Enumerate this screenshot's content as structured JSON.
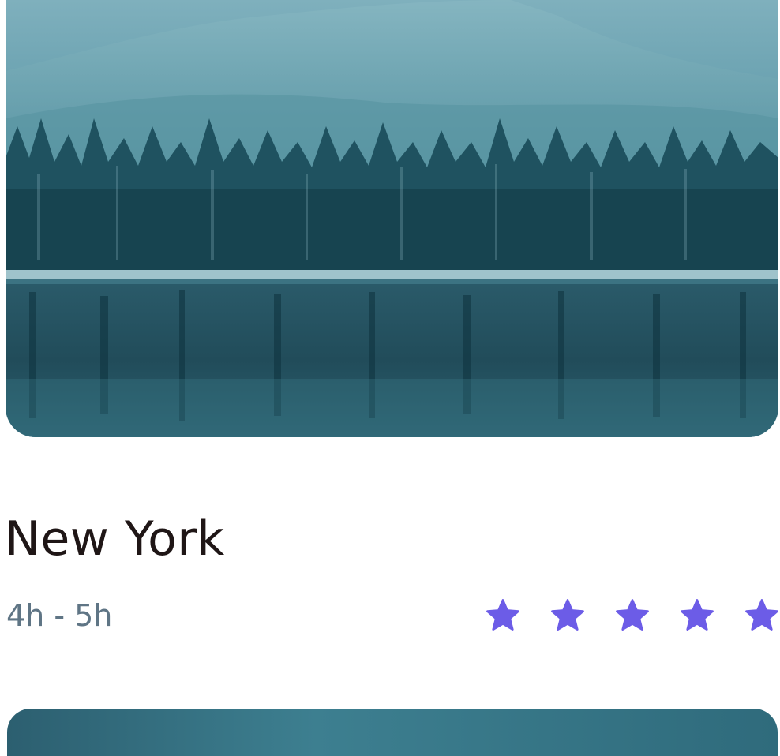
{
  "card": {
    "title": "New York",
    "duration": "4h - 5h",
    "rating": 5,
    "max_rating": 5,
    "star_color": "#6c5ce7"
  },
  "colors": {
    "title": "#1f1616",
    "duration": "#5f7585",
    "image_tint": "#2f6b7c"
  }
}
